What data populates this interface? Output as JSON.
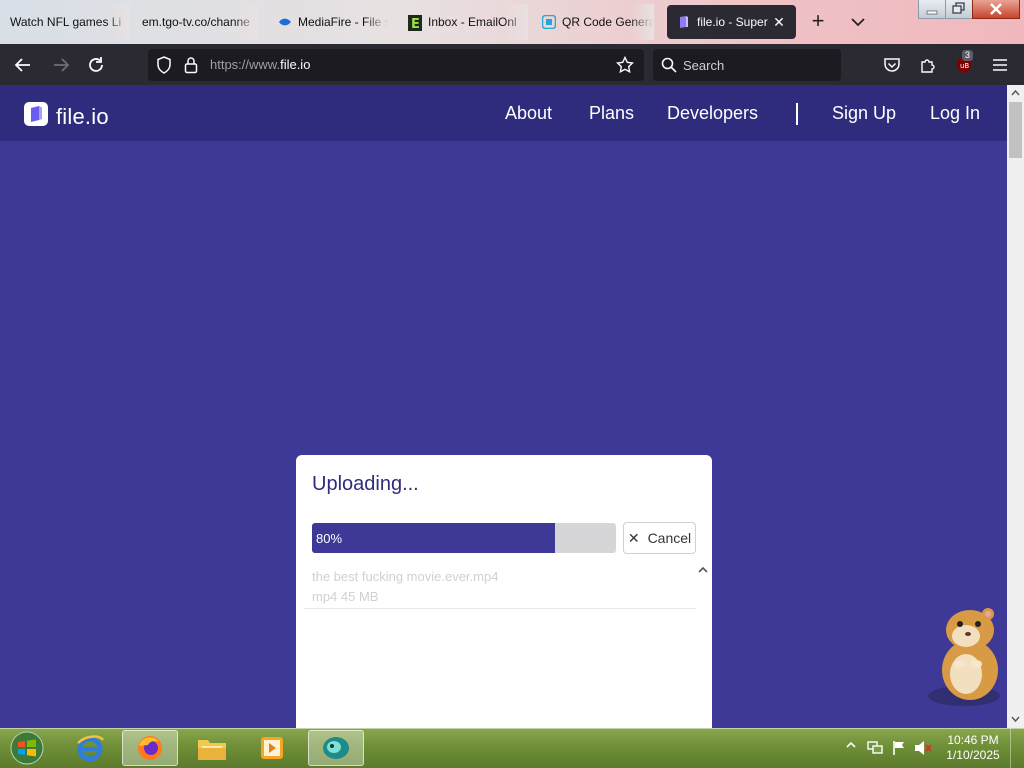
{
  "browser": {
    "tabs": [
      {
        "label": "Watch NFL games Li",
        "active": false
      },
      {
        "label": "em.tgo-tv.co/channe",
        "active": false
      },
      {
        "label": "MediaFire - File s",
        "active": false
      },
      {
        "label": "Inbox - EmailOnl",
        "active": false
      },
      {
        "label": "QR Code Genera",
        "active": false
      },
      {
        "label": "file.io - Super",
        "active": true
      }
    ],
    "url_prefix": "https://www.",
    "url_host": "file.io",
    "search_placeholder": "Search",
    "extension_badge": "3"
  },
  "site": {
    "logo_text": "file.io",
    "nav": {
      "about": "About",
      "plans": "Plans",
      "developers": "Developers",
      "signup": "Sign Up",
      "login": "Log In"
    }
  },
  "upload": {
    "title": "Uploading...",
    "progress_percent": 80,
    "progress_label": "80%",
    "cancel_label": "Cancel",
    "file_name": "the best fucking movie.ever.mp4",
    "file_meta": "mp4 45 MB"
  },
  "taskbar": {
    "time": "10:46 PM",
    "date": "1/10/2025"
  },
  "colors": {
    "page_bg": "#3e3897",
    "header_bg": "#2f2c7e",
    "browser_chrome": "#2b2a33",
    "progress_fill": "#3e3897"
  }
}
